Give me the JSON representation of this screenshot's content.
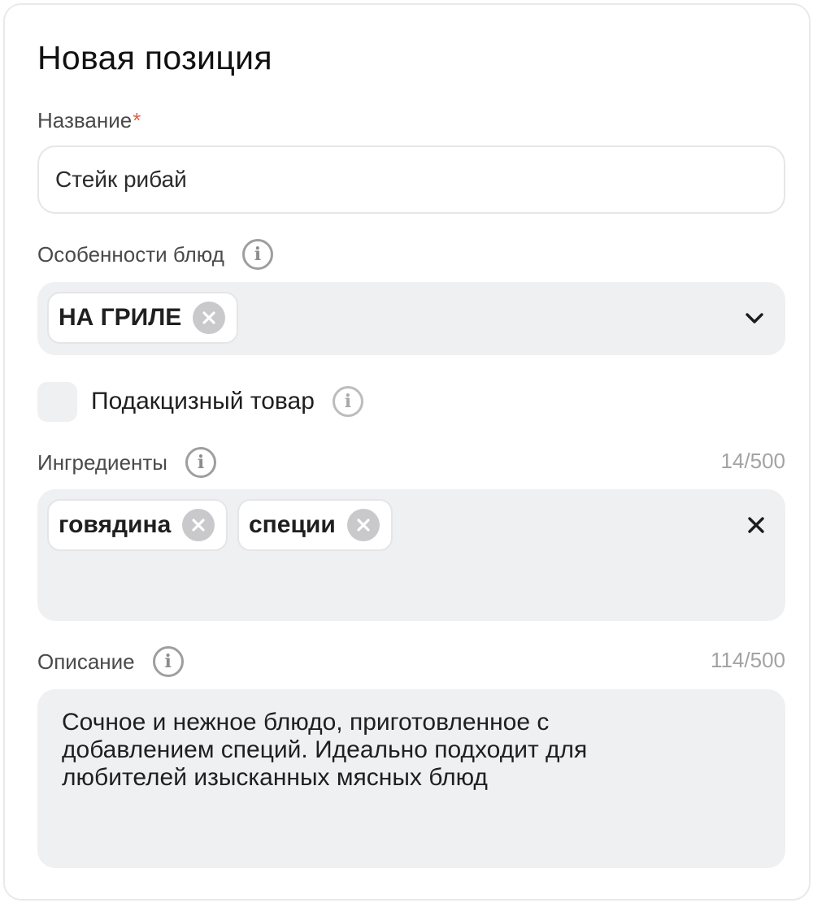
{
  "form": {
    "title": "Новая позиция",
    "name_field": {
      "label": "Название",
      "required_mark": "*",
      "value": "Стейк рибай"
    },
    "features_field": {
      "label": "Особенности блюд",
      "tags": [
        "НА ГРИЛЕ"
      ],
      "icon": "chevron-down-icon"
    },
    "excise_checkbox": {
      "label": "Подакцизный товар",
      "checked": false
    },
    "ingredients_field": {
      "label": "Ингредиенты",
      "counter": "14/500",
      "tags": [
        "говядина",
        "специи"
      ]
    },
    "description_field": {
      "label": "Описание",
      "counter": "114/500",
      "lines": [
        "Сочное и нежное блюдо, приготовленное с",
        "добавлением специй. Идеально подходит для",
        "любителей изысканных мясных блюд"
      ]
    }
  },
  "colors": {
    "required": "#e0614a",
    "field_bg": "#eff0f2",
    "muted_text": "#a3a3a3"
  }
}
